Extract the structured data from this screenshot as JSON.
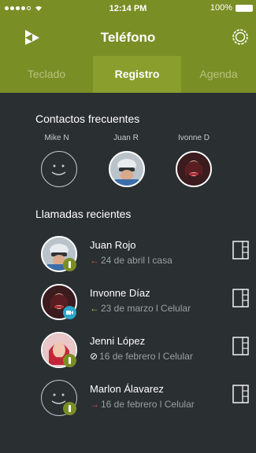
{
  "status": {
    "time": "12:14 PM",
    "battery": "100%"
  },
  "header": {
    "title": "Teléfono"
  },
  "tabs": [
    {
      "label": "Teclado",
      "active": false
    },
    {
      "label": "Registro",
      "active": true
    },
    {
      "label": "Agenda",
      "active": false
    }
  ],
  "frequent": {
    "title": "Contactos frecuentes",
    "contacts": [
      {
        "name": "Mike N",
        "avatar": "smiley-placeholder-icon"
      },
      {
        "name": "Juan R",
        "avatar": "cyclist-photo"
      },
      {
        "name": "Ivonne D",
        "avatar": "woman-photo"
      }
    ]
  },
  "recent": {
    "title": "Llamadas recientes",
    "calls": [
      {
        "name": "Juan Rojo",
        "arrow": "←",
        "arrow_color": "#d9534f",
        "date": "24 de abril",
        "type": "casa",
        "badge_icon": "phone-icon",
        "badge_color": "#7a8e26"
      },
      {
        "name": "Invonne Díaz",
        "arrow": "←",
        "arrow_color": "#a9c23f",
        "date": "23 de marzo",
        "type": "Celular",
        "badge_icon": "video-icon",
        "badge_color": "#2aa7c9"
      },
      {
        "name": "Jenni López",
        "arrow": "⊘",
        "arrow_color": "#ffffff",
        "date": "16 de febrero",
        "type": "Celular",
        "badge_icon": "phone-icon",
        "badge_color": "#7a8e26"
      },
      {
        "name": "Marlon Álavarez",
        "arrow": "→",
        "arrow_color": "#d9534f",
        "date": "16 de febrero",
        "type": "Celular",
        "badge_icon": "phone-icon",
        "badge_color": "#7a8e26"
      }
    ]
  },
  "colors": {
    "accent": "#7a8e26",
    "tab_active": "#8a9e2e",
    "background": "#2a2f31"
  }
}
